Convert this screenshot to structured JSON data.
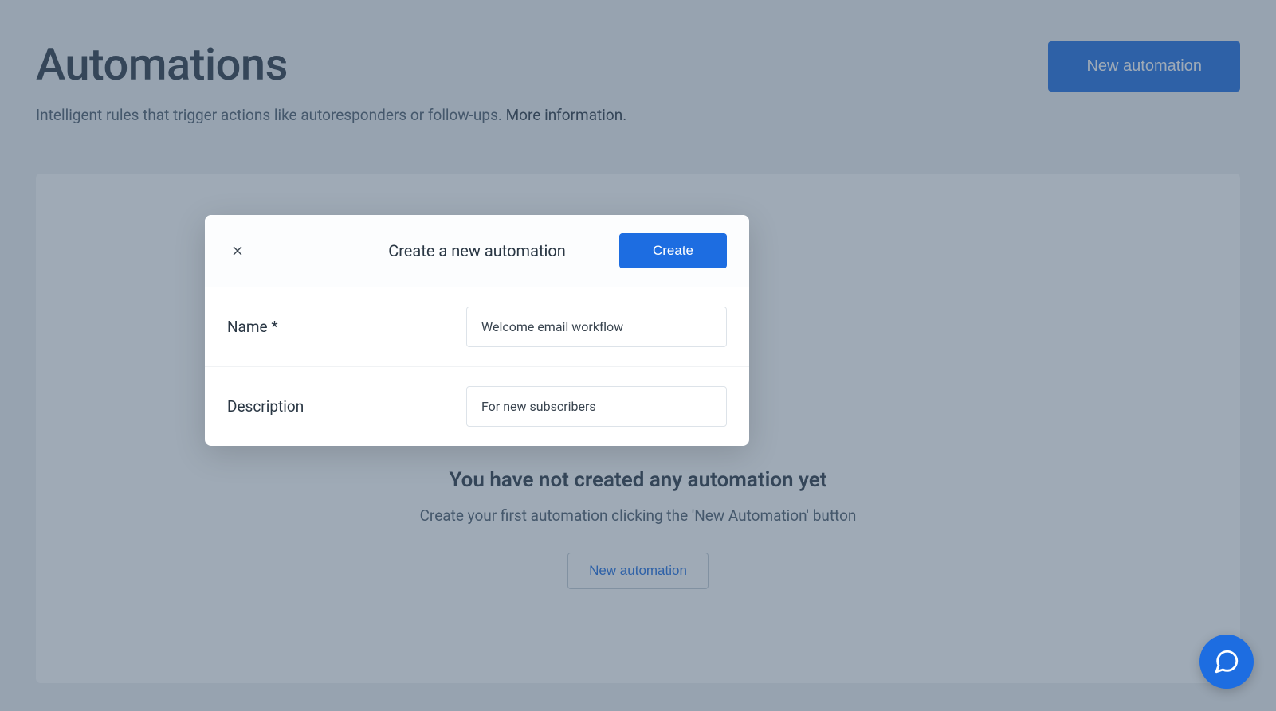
{
  "page": {
    "title": "Automations",
    "subtitle_text": "Intelligent rules that trigger actions like autoresponders or follow-ups. ",
    "more_info_label": "More information.",
    "new_automation_label": "New automation"
  },
  "empty_state": {
    "title": "You have not created any automation yet",
    "subtitle": "Create your first automation clicking the 'New Automation' button",
    "cta_label": "New automation"
  },
  "modal": {
    "title": "Create a new automation",
    "create_label": "Create",
    "fields": {
      "name": {
        "label": "Name *",
        "value": "Welcome email workflow"
      },
      "description": {
        "label": "Description",
        "value": "For new subscribers"
      }
    }
  },
  "colors": {
    "primary": "#1d6de1",
    "text_dark": "#2a3744",
    "text_muted": "#4a5a6a"
  }
}
